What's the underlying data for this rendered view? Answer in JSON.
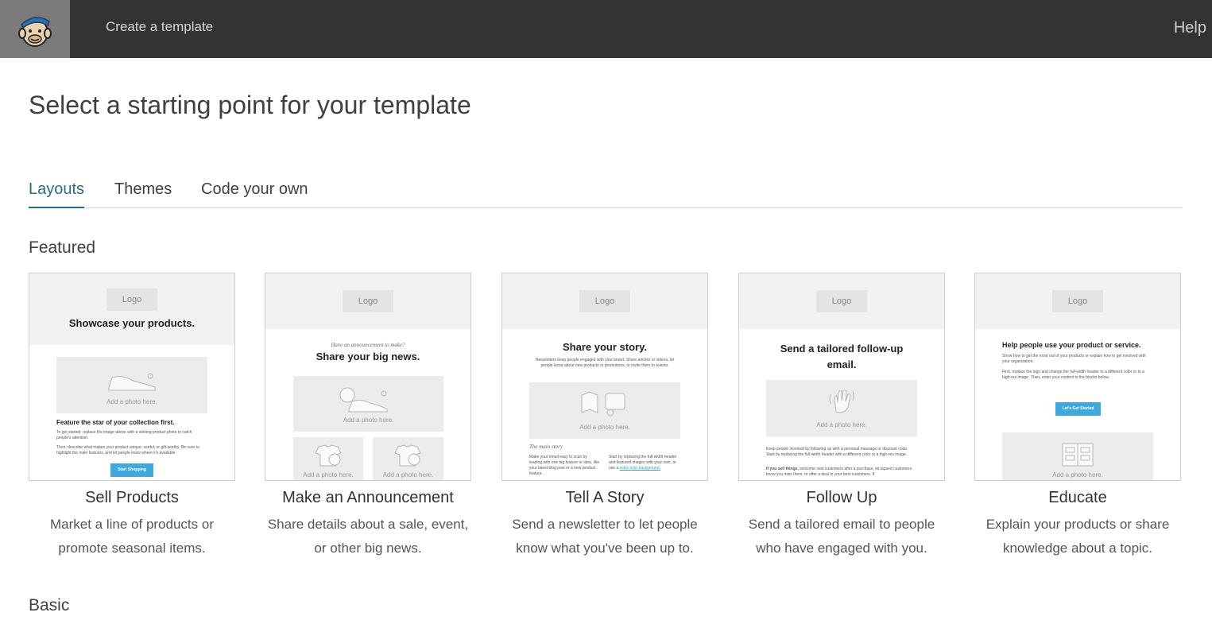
{
  "topbar": {
    "title": "Create a template",
    "help": "Help",
    "logo_icon": "freddie-logo-icon"
  },
  "page": {
    "title": "Select a starting point for your template"
  },
  "tabs": [
    {
      "label": "Layouts",
      "active": true
    },
    {
      "label": "Themes",
      "active": false
    },
    {
      "label": "Code your own",
      "active": false
    }
  ],
  "sections": {
    "featured": "Featured",
    "basic": "Basic"
  },
  "colors": {
    "topbar": "#333333",
    "accent": "#2a6a86",
    "button": "#3fa8dc"
  },
  "cards": [
    {
      "name": "Sell Products",
      "description": "Market a line of products or promote seasonal items.",
      "preview": {
        "logo": "Logo",
        "heading": "Showcase your products.",
        "photo": "Add a photo here.",
        "subheading": "Feature the star of your collection first.",
        "body1": "To get started, replace the image above with a striking product photo to catch people's attention.",
        "body2": "Then, describe what makes your product unique, useful, or gift-worthy. Be sure to highlight the main features, and let people know where it's available.",
        "button": "Start Shopping"
      }
    },
    {
      "name": "Make an Announcement",
      "description": "Share details about a sale, event, or other big news.",
      "preview": {
        "logo": "Logo",
        "kicker": "Have an announcement to make?",
        "heading": "Share your big news.",
        "photo": "Add a photo here.",
        "photo_small_1": "Add a photo here.",
        "photo_small_2": "Add a photo here."
      }
    },
    {
      "name": "Tell A Story",
      "description": "Send a newsletter to let people know what you've been up to.",
      "preview": {
        "logo": "Logo",
        "heading": "Share your story.",
        "intro": "Newsletters keep people engaged with your brand. Share articles or videos, let people know about new products or promotions, or invite them to events.",
        "photo": "Add a photo here.",
        "kicker": "The main story",
        "col1": "Make your email easy to scan by leading with one big feature or idea, like your latest blog post or a new product feature.",
        "col2": "Start by replacing the full-width header and featured images with your own, or use a",
        "col2_link": "solid color background."
      }
    },
    {
      "name": "Follow Up",
      "description": "Send a tailored email to people who have engaged with you.",
      "preview": {
        "logo": "Logo",
        "heading": "Send a tailored follow-up email.",
        "photo": "Add a photo here.",
        "body1": "Keep people involved by following up with a personal message or discount code. Start by replacing the full-width header with a different color or a high-res image.",
        "body2_bold": "If you sell things,",
        "body2": "welcome new customers after a purchase, let lapsed customers know you miss them, or offer a deal to your best customers. If"
      }
    },
    {
      "name": "Educate",
      "description": "Explain your products or share knowledge about a topic.",
      "preview": {
        "logo": "Logo",
        "heading": "Help people use your product or service.",
        "body1": "Show how to get the most out of your products or explain how to get involved with your organization.",
        "body2": "First, replace the logo and change the full-width header to a different color or to a high-res image. Then, enter your content in the blocks below.",
        "button": "Let's Get Started",
        "photo": "Add a photo here."
      }
    }
  ]
}
